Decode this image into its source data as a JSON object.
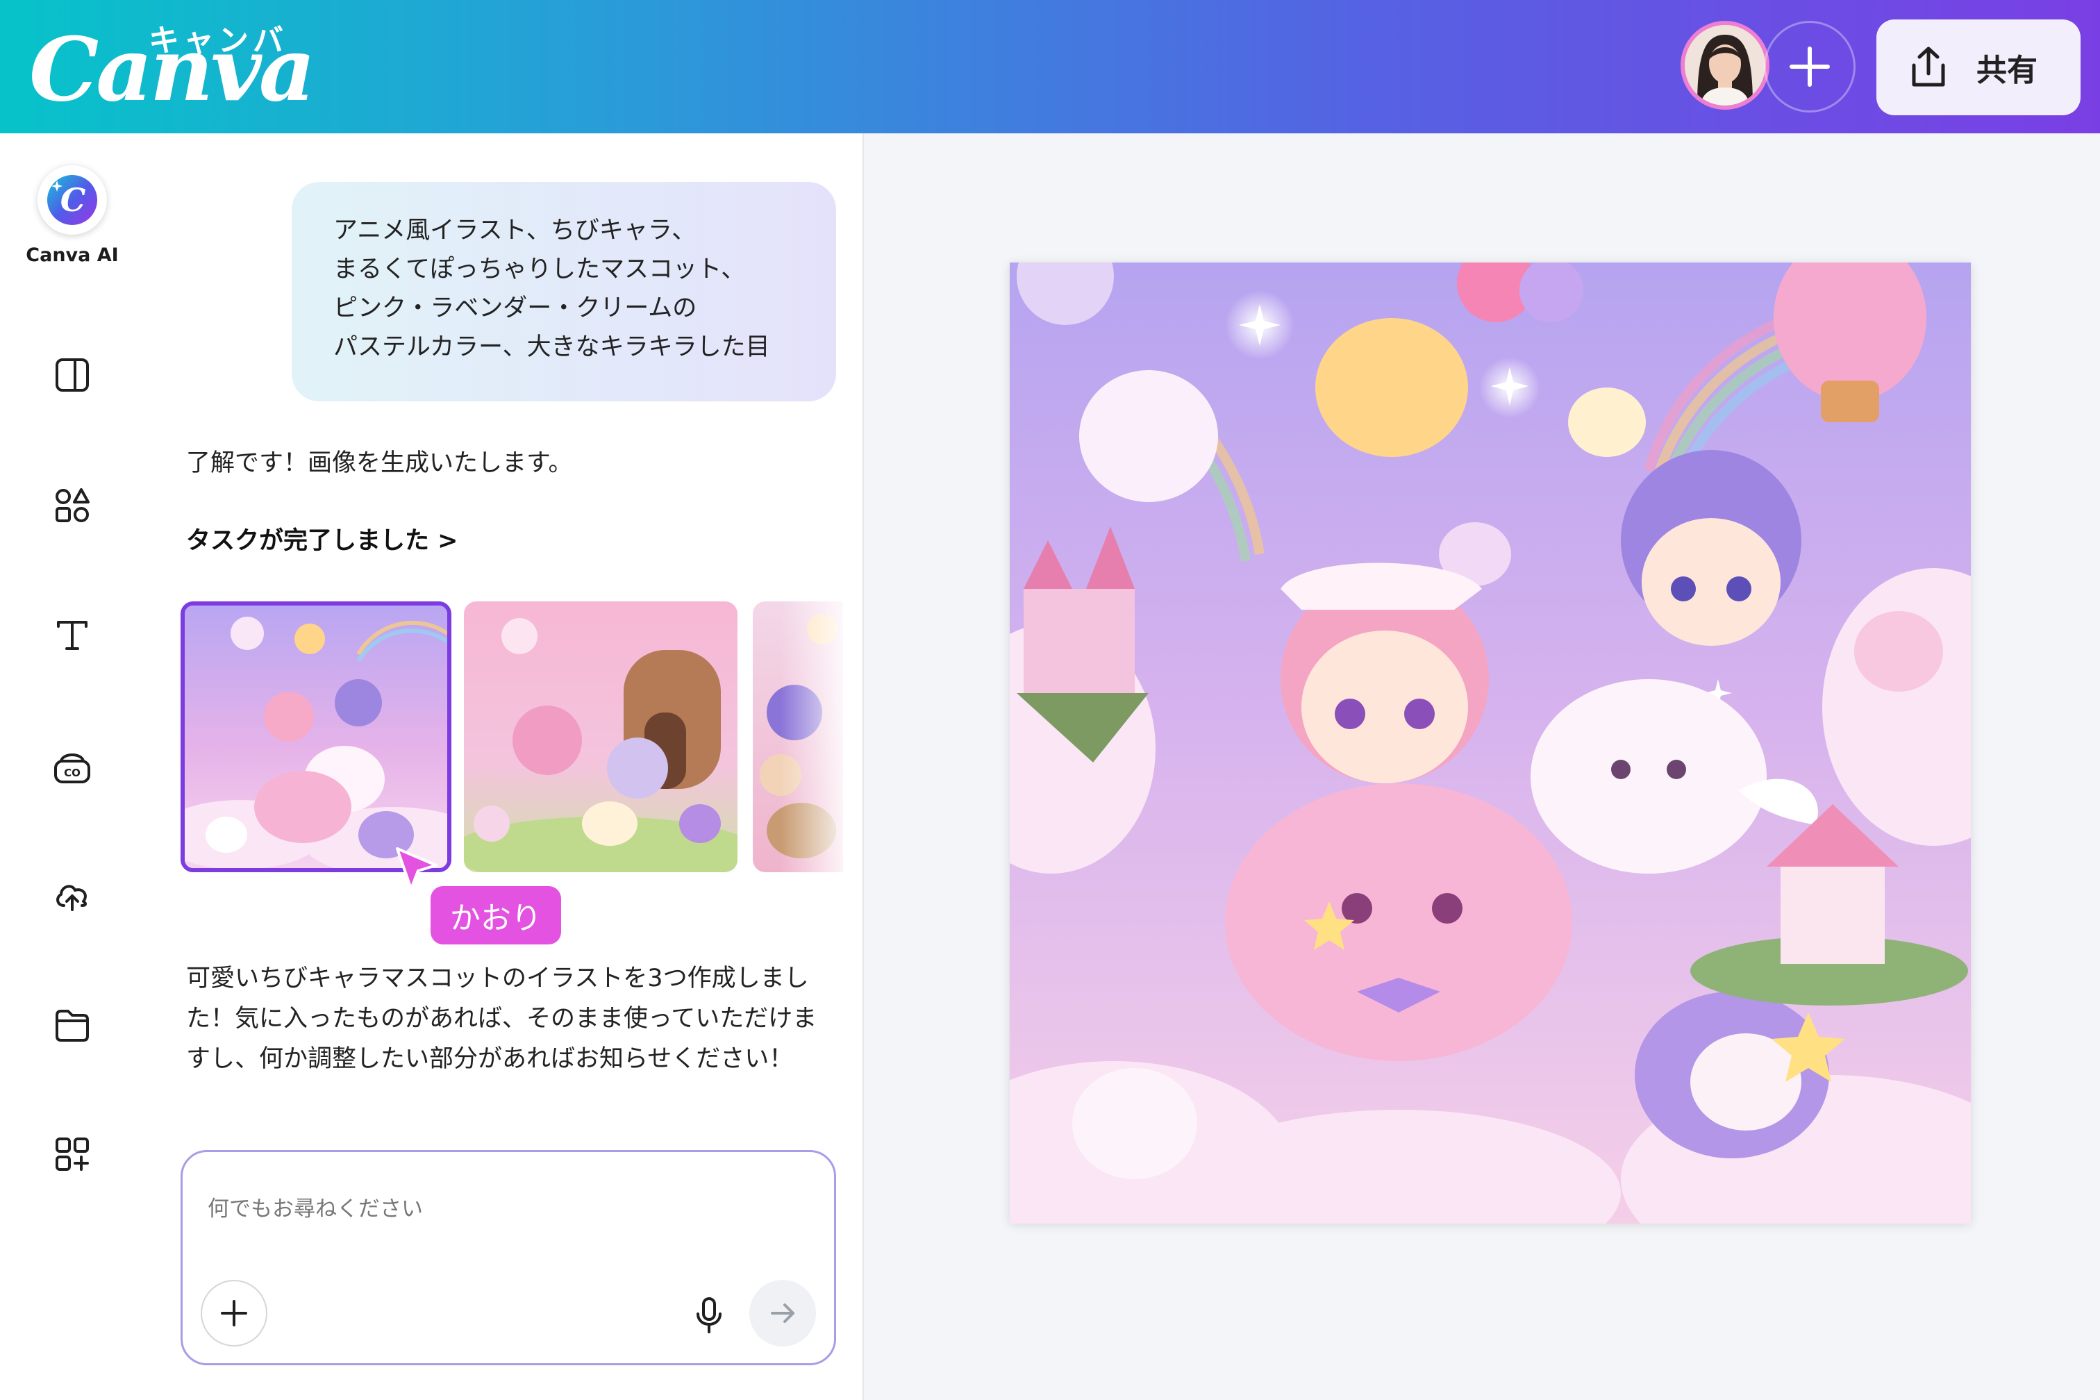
{
  "header": {
    "logo_kana": "キャンバ",
    "logo_word": "Canva",
    "share_label": "共有",
    "colors": {
      "gradient_start": "#07c3c9",
      "gradient_end": "#7a3fe4"
    }
  },
  "rail": {
    "items": [
      {
        "id": "canva-ai",
        "label": "Canva AI",
        "icon": "canva-ai-icon"
      },
      {
        "id": "design",
        "icon": "layout-panel-icon"
      },
      {
        "id": "elements",
        "icon": "shapes-icon"
      },
      {
        "id": "text",
        "icon": "text-icon"
      },
      {
        "id": "brand",
        "icon": "brand-kit-icon"
      },
      {
        "id": "uploads",
        "icon": "cloud-upload-icon"
      },
      {
        "id": "projects",
        "icon": "folder-icon"
      },
      {
        "id": "apps",
        "icon": "apps-grid-icon"
      }
    ]
  },
  "chat": {
    "user_message_lines": [
      "アニメ風イラスト、ちびキャラ、",
      "まるくてぽっちゃりしたマスコット、",
      "ピンク・ラベンダー・クリームの",
      "パステルカラー、大きなキラキラした目"
    ],
    "ai_reply_1": "了解です！画像を生成いたします。",
    "task_done": "タスクが完了しました >",
    "cursor_user": "かおり",
    "ai_reply_2": "可愛いちびキャラマスコットのイラストを3つ作成しました！気に入ったものがあれば、そのまま使っていただけますし、何か調整したい部分があればお知らせください！",
    "input_placeholder": "何でもお尋ねください"
  }
}
